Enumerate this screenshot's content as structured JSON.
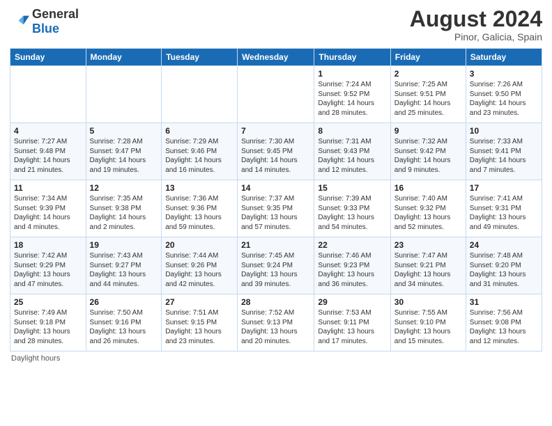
{
  "header": {
    "logo_general": "General",
    "logo_blue": "Blue",
    "month_year": "August 2024",
    "location": "Pinor, Galicia, Spain"
  },
  "days_of_week": [
    "Sunday",
    "Monday",
    "Tuesday",
    "Wednesday",
    "Thursday",
    "Friday",
    "Saturday"
  ],
  "weeks": [
    [
      {
        "day": "",
        "info": ""
      },
      {
        "day": "",
        "info": ""
      },
      {
        "day": "",
        "info": ""
      },
      {
        "day": "",
        "info": ""
      },
      {
        "day": "1",
        "info": "Sunrise: 7:24 AM\nSunset: 9:52 PM\nDaylight: 14 hours\nand 28 minutes."
      },
      {
        "day": "2",
        "info": "Sunrise: 7:25 AM\nSunset: 9:51 PM\nDaylight: 14 hours\nand 25 minutes."
      },
      {
        "day": "3",
        "info": "Sunrise: 7:26 AM\nSunset: 9:50 PM\nDaylight: 14 hours\nand 23 minutes."
      }
    ],
    [
      {
        "day": "4",
        "info": "Sunrise: 7:27 AM\nSunset: 9:48 PM\nDaylight: 14 hours\nand 21 minutes."
      },
      {
        "day": "5",
        "info": "Sunrise: 7:28 AM\nSunset: 9:47 PM\nDaylight: 14 hours\nand 19 minutes."
      },
      {
        "day": "6",
        "info": "Sunrise: 7:29 AM\nSunset: 9:46 PM\nDaylight: 14 hours\nand 16 minutes."
      },
      {
        "day": "7",
        "info": "Sunrise: 7:30 AM\nSunset: 9:45 PM\nDaylight: 14 hours\nand 14 minutes."
      },
      {
        "day": "8",
        "info": "Sunrise: 7:31 AM\nSunset: 9:43 PM\nDaylight: 14 hours\nand 12 minutes."
      },
      {
        "day": "9",
        "info": "Sunrise: 7:32 AM\nSunset: 9:42 PM\nDaylight: 14 hours\nand 9 minutes."
      },
      {
        "day": "10",
        "info": "Sunrise: 7:33 AM\nSunset: 9:41 PM\nDaylight: 14 hours\nand 7 minutes."
      }
    ],
    [
      {
        "day": "11",
        "info": "Sunrise: 7:34 AM\nSunset: 9:39 PM\nDaylight: 14 hours\nand 4 minutes."
      },
      {
        "day": "12",
        "info": "Sunrise: 7:35 AM\nSunset: 9:38 PM\nDaylight: 14 hours\nand 2 minutes."
      },
      {
        "day": "13",
        "info": "Sunrise: 7:36 AM\nSunset: 9:36 PM\nDaylight: 13 hours\nand 59 minutes."
      },
      {
        "day": "14",
        "info": "Sunrise: 7:37 AM\nSunset: 9:35 PM\nDaylight: 13 hours\nand 57 minutes."
      },
      {
        "day": "15",
        "info": "Sunrise: 7:39 AM\nSunset: 9:33 PM\nDaylight: 13 hours\nand 54 minutes."
      },
      {
        "day": "16",
        "info": "Sunrise: 7:40 AM\nSunset: 9:32 PM\nDaylight: 13 hours\nand 52 minutes."
      },
      {
        "day": "17",
        "info": "Sunrise: 7:41 AM\nSunset: 9:31 PM\nDaylight: 13 hours\nand 49 minutes."
      }
    ],
    [
      {
        "day": "18",
        "info": "Sunrise: 7:42 AM\nSunset: 9:29 PM\nDaylight: 13 hours\nand 47 minutes."
      },
      {
        "day": "19",
        "info": "Sunrise: 7:43 AM\nSunset: 9:27 PM\nDaylight: 13 hours\nand 44 minutes."
      },
      {
        "day": "20",
        "info": "Sunrise: 7:44 AM\nSunset: 9:26 PM\nDaylight: 13 hours\nand 42 minutes."
      },
      {
        "day": "21",
        "info": "Sunrise: 7:45 AM\nSunset: 9:24 PM\nDaylight: 13 hours\nand 39 minutes."
      },
      {
        "day": "22",
        "info": "Sunrise: 7:46 AM\nSunset: 9:23 PM\nDaylight: 13 hours\nand 36 minutes."
      },
      {
        "day": "23",
        "info": "Sunrise: 7:47 AM\nSunset: 9:21 PM\nDaylight: 13 hours\nand 34 minutes."
      },
      {
        "day": "24",
        "info": "Sunrise: 7:48 AM\nSunset: 9:20 PM\nDaylight: 13 hours\nand 31 minutes."
      }
    ],
    [
      {
        "day": "25",
        "info": "Sunrise: 7:49 AM\nSunset: 9:18 PM\nDaylight: 13 hours\nand 28 minutes."
      },
      {
        "day": "26",
        "info": "Sunrise: 7:50 AM\nSunset: 9:16 PM\nDaylight: 13 hours\nand 26 minutes."
      },
      {
        "day": "27",
        "info": "Sunrise: 7:51 AM\nSunset: 9:15 PM\nDaylight: 13 hours\nand 23 minutes."
      },
      {
        "day": "28",
        "info": "Sunrise: 7:52 AM\nSunset: 9:13 PM\nDaylight: 13 hours\nand 20 minutes."
      },
      {
        "day": "29",
        "info": "Sunrise: 7:53 AM\nSunset: 9:11 PM\nDaylight: 13 hours\nand 17 minutes."
      },
      {
        "day": "30",
        "info": "Sunrise: 7:55 AM\nSunset: 9:10 PM\nDaylight: 13 hours\nand 15 minutes."
      },
      {
        "day": "31",
        "info": "Sunrise: 7:56 AM\nSunset: 9:08 PM\nDaylight: 13 hours\nand 12 minutes."
      }
    ]
  ],
  "footer": {
    "note": "Daylight hours"
  }
}
